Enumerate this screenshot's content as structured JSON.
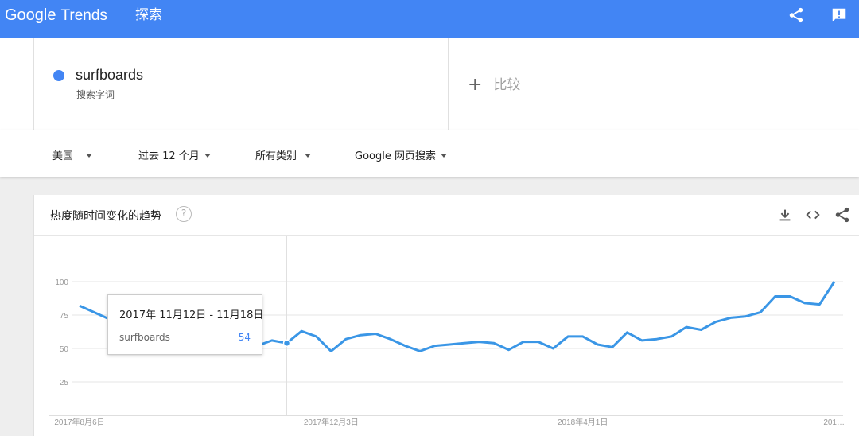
{
  "topbar": {
    "logo_google": "Google",
    "logo_trends": "Trends",
    "explore": "探索",
    "icons": [
      "share-icon",
      "feedback-icon"
    ],
    "color": "#4285f4"
  },
  "search": {
    "term": "surfboards",
    "term_type": "搜索字词",
    "compare_label": "比较",
    "term_color": "#4285f4"
  },
  "filters": {
    "region": "美国",
    "time": "过去 12 个月",
    "category": "所有类别",
    "search_type": "Google 网页搜索"
  },
  "card": {
    "title": "热度随时间变化的趋势",
    "help": "?",
    "icons": [
      "download-icon",
      "embed-icon",
      "share-icon"
    ]
  },
  "tooltip": {
    "date": "2017年 11月12日 - 11月18日",
    "term": "surfboards",
    "value": "54"
  },
  "chart_data": {
    "type": "line",
    "series": [
      {
        "name": "surfboards",
        "color": "#3a96e6",
        "values": [
          82,
          77,
          72,
          66,
          73,
          67,
          66,
          66,
          56,
          64,
          57,
          59,
          52,
          56,
          54,
          63,
          59,
          48,
          57,
          60,
          61,
          57,
          52,
          48,
          52,
          53,
          54,
          55,
          54,
          49,
          55,
          55,
          50,
          59,
          59,
          53,
          51,
          62,
          56,
          57,
          59,
          66,
          64,
          70,
          73,
          74,
          77,
          89,
          89,
          84,
          83,
          100
        ]
      }
    ],
    "x_ticks": [
      {
        "label": "2017年8月6日",
        "index": 0
      },
      {
        "label": "2017年12月3日",
        "index": 17
      },
      {
        "label": "2018年4月1日",
        "index": 34
      },
      {
        "label": "201…",
        "index": 51
      }
    ],
    "y_ticks": [
      25,
      50,
      75,
      100
    ],
    "ylim": [
      0,
      100
    ],
    "highlight_index": 14,
    "grid": true
  }
}
